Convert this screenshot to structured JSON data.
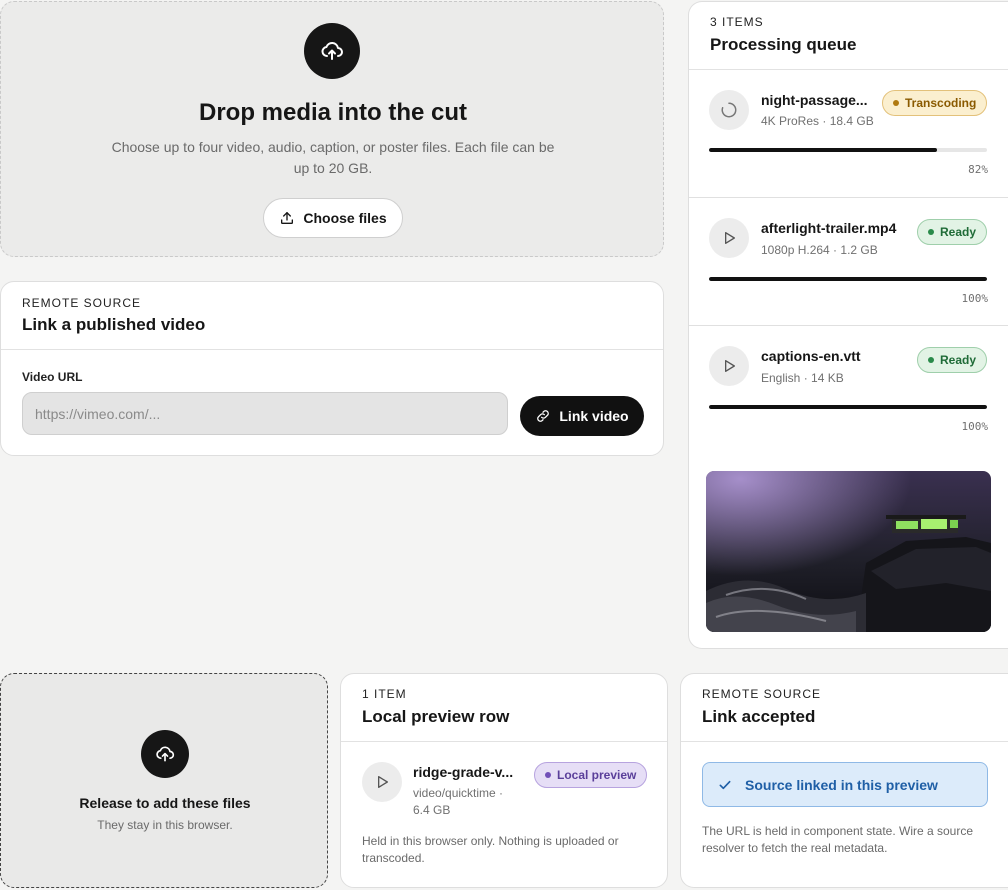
{
  "upload": {
    "title": "Drop media into the cut",
    "description": "Choose up to four video, audio, caption, or poster files. Each file can be up to 20 GB.",
    "choose_button": "Choose files"
  },
  "remote_link": {
    "eyebrow": "REMOTE SOURCE",
    "title": "Link a published video",
    "field_label": "Video URL",
    "placeholder": "https://vimeo.com/...",
    "button": "Link video"
  },
  "queue": {
    "eyebrow": "3 ITEMS",
    "title": "Processing queue",
    "items": [
      {
        "name": "night-passage...",
        "meta": "4K ProRes · 18.4 GB",
        "status": "Transcoding",
        "progress": 82,
        "progress_label": "82%"
      },
      {
        "name": "afterlight-trailer.mp4",
        "meta": "1080p H.264 · 1.2 GB",
        "status": "Ready",
        "progress": 100,
        "progress_label": "100%"
      },
      {
        "name": "captions-en.vtt",
        "meta": "English · 14 KB",
        "status": "Ready",
        "progress": 100,
        "progress_label": "100%"
      }
    ]
  },
  "release_drop": {
    "title": "Release to add these files",
    "subtitle": "They stay in this browser."
  },
  "local_preview": {
    "eyebrow": "1 ITEM",
    "title": "Local preview row",
    "item": {
      "name": "ridge-grade-v...",
      "meta_line1": "video/quicktime ·",
      "meta_line2": "6.4 GB",
      "status": "Local preview"
    },
    "note": "Held in this browser only. Nothing is uploaded or transcoded."
  },
  "link_accepted": {
    "eyebrow": "REMOTE SOURCE",
    "title": "Link accepted",
    "success": "Source linked in this preview",
    "note": "The URL is held in component state. Wire a source resolver to fetch the real metadata."
  },
  "colors": {
    "accent_dark": "#111111",
    "transcoding_bg": "#fbefcf",
    "transcoding_text": "#8a5a00",
    "ready_bg": "#e2f3e5",
    "ready_text": "#1f6b37",
    "local_bg": "#e6def6",
    "local_text": "#5a3f9a",
    "success_bg": "#dcebfa",
    "success_text": "#1f5fa6"
  },
  "icons": [
    "upload-cloud-icon",
    "upload-icon",
    "link-icon",
    "spinner-icon",
    "play-icon",
    "check-icon"
  ]
}
